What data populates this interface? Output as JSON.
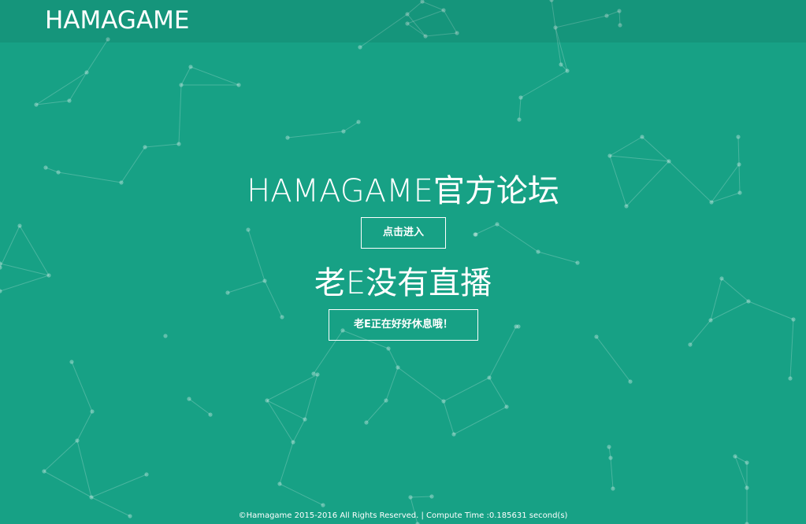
{
  "header": {
    "brand": "HAMAGAME"
  },
  "hero": {
    "forum_title": "HAMAGAME官方论坛",
    "forum_button": "点击进入",
    "live_title": "老E没有直播",
    "live_button": "老E正在好好休息哦！"
  },
  "footer": {
    "copyright": "©Hamagame 2015-2016 All Rights Reserved. | Compute Time :0.185631 second(s)"
  },
  "colors": {
    "background": "#17a185",
    "header_bar": "#14947a",
    "text": "#ffffff"
  }
}
